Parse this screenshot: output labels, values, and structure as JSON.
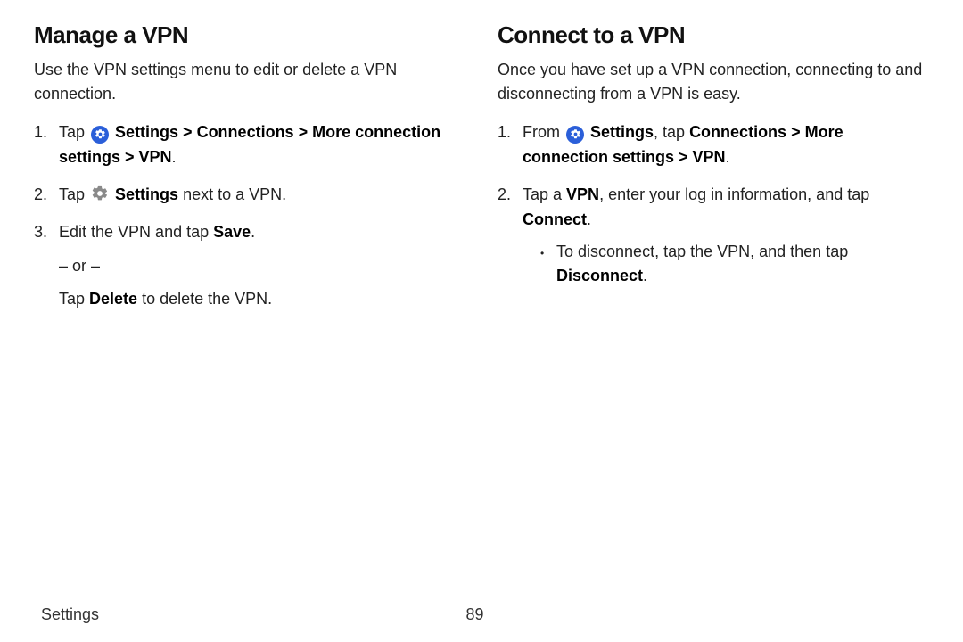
{
  "left": {
    "heading": "Manage a VPN",
    "intro": "Use the VPN settings menu to edit or delete a VPN connection.",
    "step1_prefix": "Tap ",
    "step1_bold": "Settings > Connections > More connection settings > VPN",
    "step2_prefix": "Tap ",
    "step2_bold": "Settings",
    "step2_suffix": " next to a VPN.",
    "step3_prefix": "Edit the VPN and tap ",
    "step3_bold": "Save",
    "step3_or": "– or –",
    "step3_alt_prefix": "Tap ",
    "step3_alt_bold": "Delete",
    "step3_alt_suffix": " to delete the VPN."
  },
  "right": {
    "heading": "Connect to a VPN",
    "intro": "Once you have set up a VPN connection, connecting to and disconnecting from a VPN is easy.",
    "step1_prefix": "From ",
    "step1_mid1": "Settings",
    "step1_mid2": ", tap ",
    "step1_bold": "Connections > More connection settings > VPN",
    "step2_prefix": "Tap a ",
    "step2_bold1": "VPN",
    "step2_mid": ", enter your log in information, and tap ",
    "step2_bold2": "Connect",
    "bullet_prefix": "To disconnect, tap the VPN, and then tap ",
    "bullet_bold": "Disconnect"
  },
  "footer": {
    "section": "Settings",
    "page": "89"
  }
}
